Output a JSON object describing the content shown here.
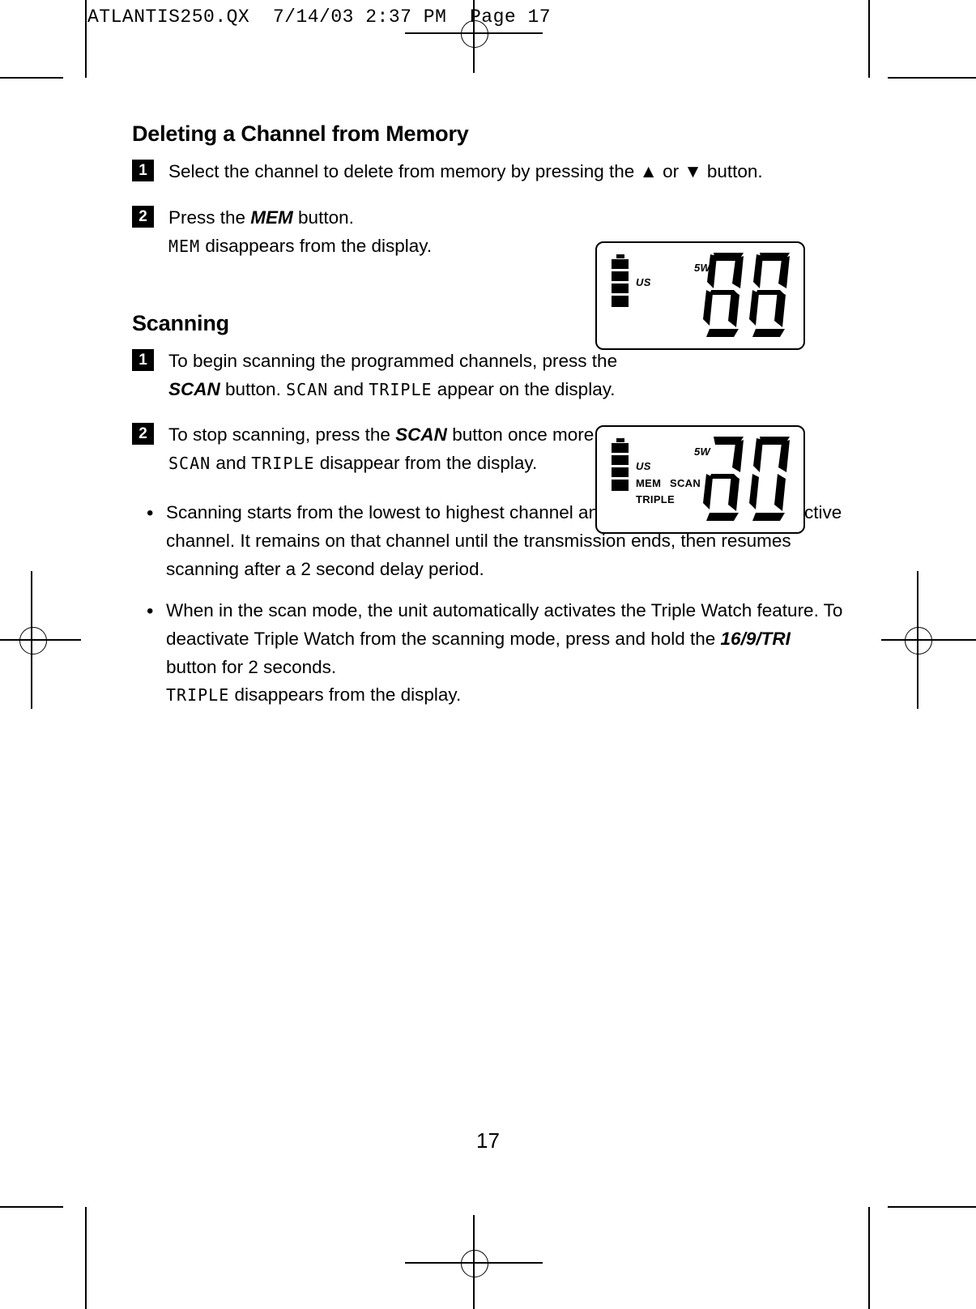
{
  "print_slug": "ATLANTIS250.QX  7/14/03 2:37 PM  Page 17",
  "page_number": "17",
  "sections": [
    {
      "id": "deleting",
      "title": "Deleting a Channel from Memory",
      "steps": [
        {
          "num": "1",
          "text_parts": [
            {
              "type": "plain",
              "text": "Select the channel to delete from memory by pressing the "
            },
            {
              "type": "glyph",
              "text": "▲"
            },
            {
              "type": "plain",
              "text": " or "
            },
            {
              "type": "glyph",
              "text": "▼"
            },
            {
              "type": "plain",
              "text": " button."
            }
          ],
          "full_text": "Select the channel to delete from memory by pressing the ▲ or ▼ button."
        },
        {
          "num": "2",
          "full_text": "Press the MEM button. MEM disappears from the display.",
          "line1_pre": "Press the ",
          "line1_bold": "MEM",
          "line1_post": " button.",
          "line2_lcd": "MEM",
          "line2_post": " disappears from the display."
        }
      ]
    },
    {
      "id": "scanning",
      "title": "Scanning",
      "steps": [
        {
          "num": "1",
          "full_text": "To begin scanning the programmed channels, press the SCAN button. SCAN and TRIPLE appear on the display.",
          "pre": "To begin scanning the programmed channels, press the ",
          "bold": "SCAN",
          "mid": " button. ",
          "lcd1": "SCAN",
          "mid2": " and ",
          "lcd2": "TRIPLE",
          "post": " appear on the display."
        },
        {
          "num": "2",
          "full_text": "To stop scanning, press the SCAN button once more. SCAN and TRIPLE disappear from the display.",
          "pre": "To stop scanning, press the ",
          "bold": "SCAN",
          "mid": " button once more. ",
          "lcd1": "SCAN",
          "mid2": " and ",
          "lcd2": "TRIPLE",
          "post": " disappear from the display."
        }
      ],
      "bullets": [
        {
          "full_text": "Scanning starts from the lowest to highest channel and stops when it finds an active channel. It remains on that channel until the transmission ends, then resumes scanning after a 2 second delay period."
        },
        {
          "pre": "When in the scan mode, the unit automatically activates the Triple Watch feature. To deactivate Triple Watch from the scanning mode, press and hold the ",
          "bold": "16/9/TRI",
          "post": " button for 2 seconds.",
          "lcd_line_word": "TRIPLE",
          "lcd_line_post": " disappears from the display."
        }
      ]
    }
  ],
  "lcd_panels": [
    {
      "id": "lcd-delete",
      "digits": "88",
      "labels": {
        "us": "US",
        "power": "5W",
        "mem": "",
        "scan": "",
        "triple": ""
      },
      "battery_segments": 4
    },
    {
      "id": "lcd-scan",
      "digits": "20",
      "labels": {
        "us": "US",
        "power": "5W",
        "mem": "MEM",
        "scan": "SCAN",
        "triple": "TRIPLE"
      },
      "battery_segments": 4
    }
  ]
}
